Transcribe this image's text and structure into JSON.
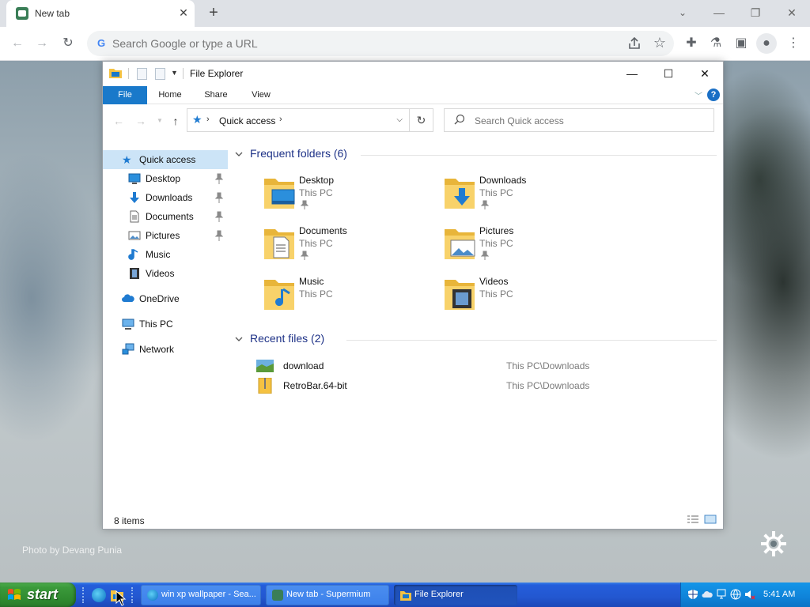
{
  "browser": {
    "tab_title": "New tab",
    "omnibox_placeholder": "Search Google or type a URL"
  },
  "newtab": {
    "photo_credit": "Photo by Devang Punia"
  },
  "explorer": {
    "title": "File Explorer",
    "ribbon_tabs": [
      "File",
      "Home",
      "Share",
      "View"
    ],
    "breadcrumb": "Quick access",
    "search_placeholder": "Search Quick access",
    "nav": [
      {
        "label": "Quick access",
        "icon": "quick-access-star-icon"
      },
      {
        "label": "Desktop",
        "icon": "desktop-icon",
        "pinned": true
      },
      {
        "label": "Downloads",
        "icon": "downloads-icon",
        "pinned": true
      },
      {
        "label": "Documents",
        "icon": "documents-icon",
        "pinned": true
      },
      {
        "label": "Pictures",
        "icon": "pictures-icon",
        "pinned": true
      },
      {
        "label": "Music",
        "icon": "music-icon"
      },
      {
        "label": "Videos",
        "icon": "videos-icon"
      },
      {
        "label": "OneDrive",
        "icon": "onedrive-cloud-icon"
      },
      {
        "label": "This PC",
        "icon": "this-pc-icon"
      },
      {
        "label": "Network",
        "icon": "network-icon"
      }
    ],
    "frequent_header": "Frequent folders (6)",
    "folders": [
      {
        "name": "Desktop",
        "location": "This PC",
        "pinned": true
      },
      {
        "name": "Downloads",
        "location": "This PC",
        "pinned": true
      },
      {
        "name": "Documents",
        "location": "This PC",
        "pinned": true
      },
      {
        "name": "Pictures",
        "location": "This PC",
        "pinned": true
      },
      {
        "name": "Music",
        "location": "This PC",
        "pinned": false
      },
      {
        "name": "Videos",
        "location": "This PC",
        "pinned": false
      }
    ],
    "recent_header": "Recent files (2)",
    "recent_files": [
      {
        "name": "download",
        "path": "This PC\\Downloads"
      },
      {
        "name": "RetroBar.64-bit",
        "path": "This PC\\Downloads"
      }
    ],
    "status": "8 items"
  },
  "taskbar": {
    "start_label": "start",
    "tasks": [
      {
        "label": "win xp wallpaper - Sea...",
        "icon": "edge-icon"
      },
      {
        "label": "New tab - Supermium",
        "icon": "supermium-icon"
      },
      {
        "label": "File Explorer",
        "icon": "file-explorer-icon"
      }
    ],
    "clock": "5:41 AM"
  },
  "colors": {
    "accent": "#1979ca",
    "xp_taskbar": "#245edb",
    "start_green": "#3b9a3b",
    "folder_yellow": "#f5c242",
    "group_header": "#1e3287"
  }
}
